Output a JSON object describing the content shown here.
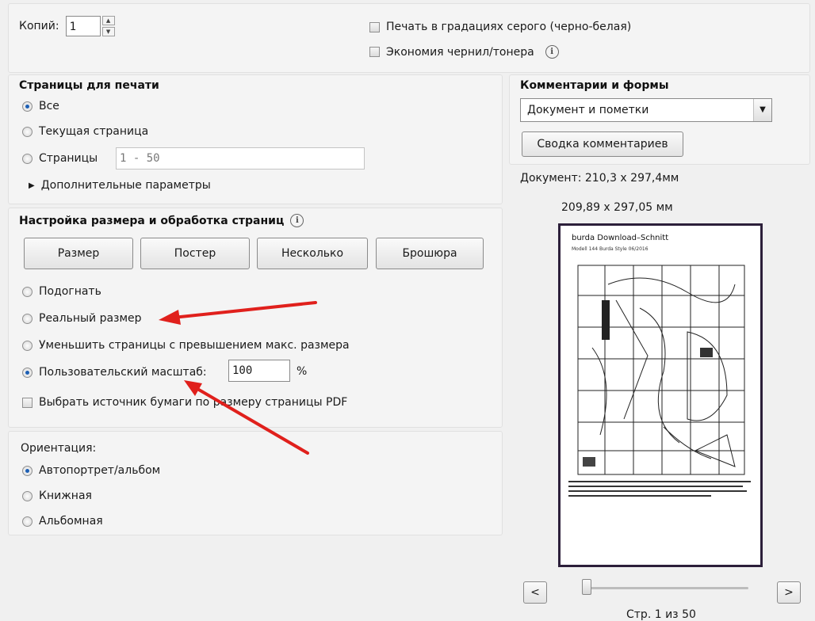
{
  "top": {
    "copies_label": "Копий:",
    "copies_value": "1",
    "grayscale_label": "Печать в градациях серого (черно-белая)",
    "ink_save_label": "Экономия чернил/тонера",
    "info_glyph": "i"
  },
  "pages": {
    "title": "Страницы для печати",
    "all": "Все",
    "current": "Текущая страница",
    "pages_label": "Страницы",
    "pages_value": "1 - 50",
    "more_options": "Дополнительные параметры",
    "selected": "all"
  },
  "sizing": {
    "title": "Настройка размера и обработка страниц",
    "buttons": [
      "Размер",
      "Постер",
      "Несколько",
      "Брошюра"
    ],
    "fit": "Подогнать",
    "actual": "Реальный размер",
    "shrink": "Уменьшить страницы с превышением макс. размера",
    "custom": "Пользовательский масштаб:",
    "custom_value": "100",
    "percent": "%",
    "paper_source": "Выбрать источник бумаги по размеру страницы PDF",
    "selected": "custom"
  },
  "orientation": {
    "title": "Ориентация:",
    "auto": "Автопортрет/альбом",
    "portrait": "Книжная",
    "landscape": "Альбомная",
    "selected": "auto"
  },
  "comments": {
    "title": "Комментарии и формы",
    "dropdown_value": "Документ и пометки",
    "summary_button": "Сводка комментариев"
  },
  "preview": {
    "document_size": "Документ: 210,3 x 297,4мм",
    "paper_size": "209,89 x 297,05 мм",
    "page_heading": "burda Download–Schnitt",
    "page_subheading": "Modell 144 Burda Style 06/2016",
    "prev": "<",
    "next": ">",
    "page_counter": "Стр. 1 из 50"
  },
  "colors": {
    "radio_selected": "#1d5fb4",
    "arrow": "#e0201c",
    "preview_border": "#2c1f3a"
  }
}
